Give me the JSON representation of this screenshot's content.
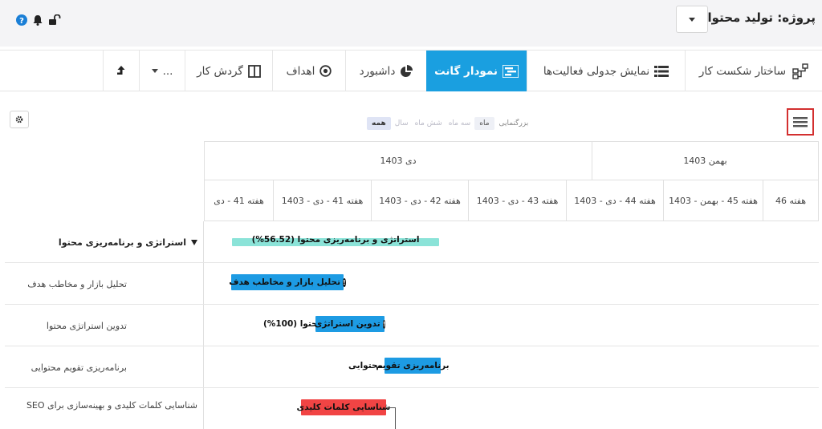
{
  "project": {
    "label": "پروژه:",
    "name": "تولید محتوا"
  },
  "top_icons": [
    "help-icon",
    "bell-icon",
    "unlock-icon"
  ],
  "tabs": [
    {
      "label": "ساختار شکست کار",
      "icon": "hierarchy-icon",
      "active": false
    },
    {
      "label": "نمایش جدولی فعالیت‌ها",
      "icon": "table-list-icon",
      "active": false
    },
    {
      "label": "نمودار گانت",
      "icon": "gantt-icon",
      "active": true
    },
    {
      "label": "داشبورد",
      "icon": "pie-chart-icon",
      "active": false
    },
    {
      "label": "اهداف",
      "icon": "target-icon",
      "active": false
    },
    {
      "label": "گردش کار",
      "icon": "columns-icon",
      "active": false
    },
    {
      "label": "...",
      "icon": "chevron-down-icon",
      "active": false
    },
    {
      "label": "",
      "icon": "export-icon",
      "active": false
    }
  ],
  "zoom": {
    "label": "بزرگنمایی",
    "options": [
      "ماه",
      "سه ماه",
      "شش ماه",
      "سال",
      "همه"
    ],
    "selected": "همه"
  },
  "timeline": {
    "months": [
      "بهمن 1403",
      "دی 1403"
    ],
    "weeks": [
      "هفته 46",
      "هفته 45 - بهمن - 1403",
      "هفته 44 - دی - 1403",
      "هفته 43 - دی - 1403",
      "هفته 42 - دی - 1403",
      "هفته 41 - دی - 1403",
      "هفته 41 - دی"
    ]
  },
  "rows": [
    {
      "label": "استراتژی و برنامه‌ریزی محتوا",
      "bar_text": "استراتژی و برنامه‌ریزی محتوا (56.52%)",
      "progress_percent": 56.52,
      "color": "#8be3d8"
    },
    {
      "label": "تحلیل بازار و مخاطب هدف",
      "bar_text": "تحلیل بازار و مخاطب هدف",
      "color": "#1d9be3"
    },
    {
      "label": "تدوین استراتژی محتوا",
      "bar_text": "تدوین استراتژی",
      "bar_ext": "محتوا (100%)",
      "progress_percent": 100,
      "color": "#1d9be3"
    },
    {
      "label": "برنامه‌ریزی تقویم محتوایی",
      "bar_text": "برنامه‌ریزی تقویم",
      "bar_ext": "محتوایی",
      "color": "#1d9be3"
    },
    {
      "label": "شناسایی کلمات کلیدی و بهینه‌سازی برای SEO",
      "bar_text": "شناسایی کلمات کلیدی",
      "color": "#f14444"
    }
  ],
  "colors": {
    "accent": "#1a9fe0",
    "highlight_border": "#d32f2f"
  }
}
